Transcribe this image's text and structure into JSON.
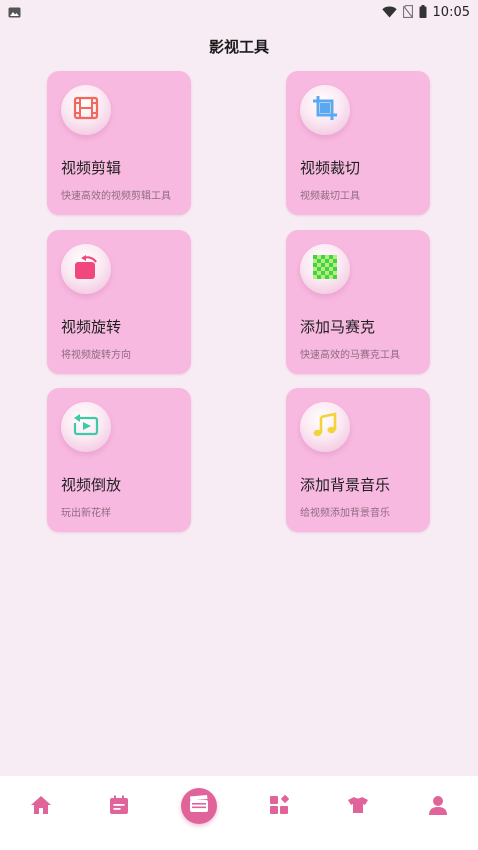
{
  "status_bar": {
    "time": "10:05",
    "icons": [
      "gallery-notification-icon",
      "wifi-icon",
      "no-sim-icon",
      "battery-icon"
    ]
  },
  "header": {
    "title": "影视工具"
  },
  "tools": [
    {
      "title": "视频剪辑",
      "desc": "快速高效的视频剪辑工具",
      "icon": "film-strip-icon"
    },
    {
      "title": "视频裁切",
      "desc": "视频裁切工具",
      "icon": "crop-icon"
    },
    {
      "title": "视频旋转",
      "desc": "将视频旋转方向",
      "icon": "rotate-icon"
    },
    {
      "title": "添加马赛克",
      "desc": "快速高效的马赛克工具",
      "icon": "mosaic-icon"
    },
    {
      "title": "视频倒放",
      "desc": "玩出新花样",
      "icon": "reverse-play-icon"
    },
    {
      "title": "添加背景音乐",
      "desc": "给视频添加背景音乐",
      "icon": "music-note-icon"
    }
  ],
  "bottom_nav": {
    "items": [
      "home-icon",
      "calendar-icon",
      "clapperboard-icon",
      "apps-grid-icon",
      "tshirt-icon",
      "profile-icon"
    ],
    "active_color": "#e0649a"
  },
  "colors": {
    "background": "#f8ecf4",
    "card": "#f8b9e0",
    "accent": "#e0649a"
  }
}
